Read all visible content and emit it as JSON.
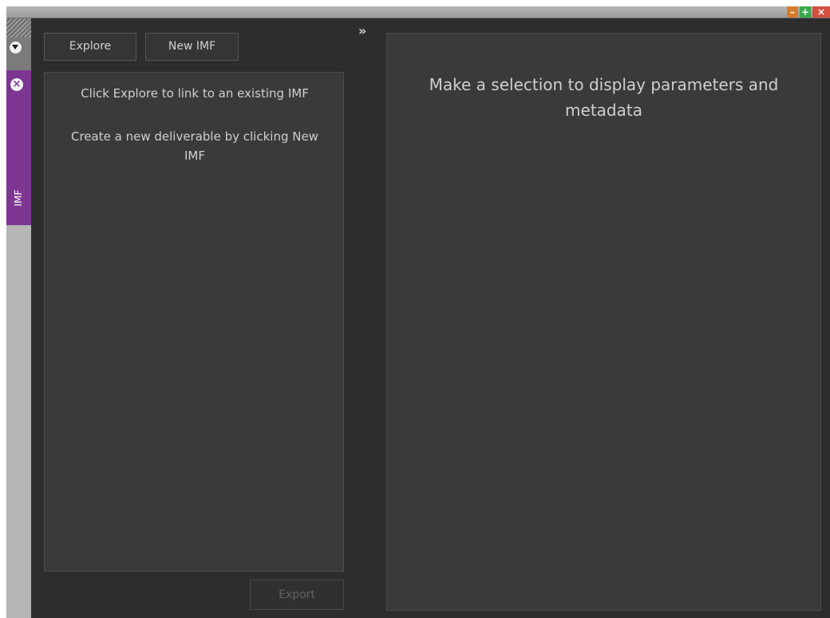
{
  "window": {
    "minimize_glyph": "–",
    "maximize_glyph": "+",
    "close_glyph": "×"
  },
  "sidebar": {
    "collapse_icon": "chevron-down-icon",
    "close_icon": "close-icon",
    "close_glyph": "×",
    "tab_label": "IMF",
    "accent_color": "#7d3793"
  },
  "toolbar": {
    "explore_label": "Explore",
    "new_imf_label": "New IMF",
    "expand_glyph": "»"
  },
  "left_panel": {
    "hint_explore": "Click Explore to link to an existing IMF",
    "hint_new": "Create a new deliverable by clicking New IMF"
  },
  "right_panel": {
    "message": "Make a selection to display parameters and metadata"
  },
  "footer": {
    "export_label": "Export"
  }
}
